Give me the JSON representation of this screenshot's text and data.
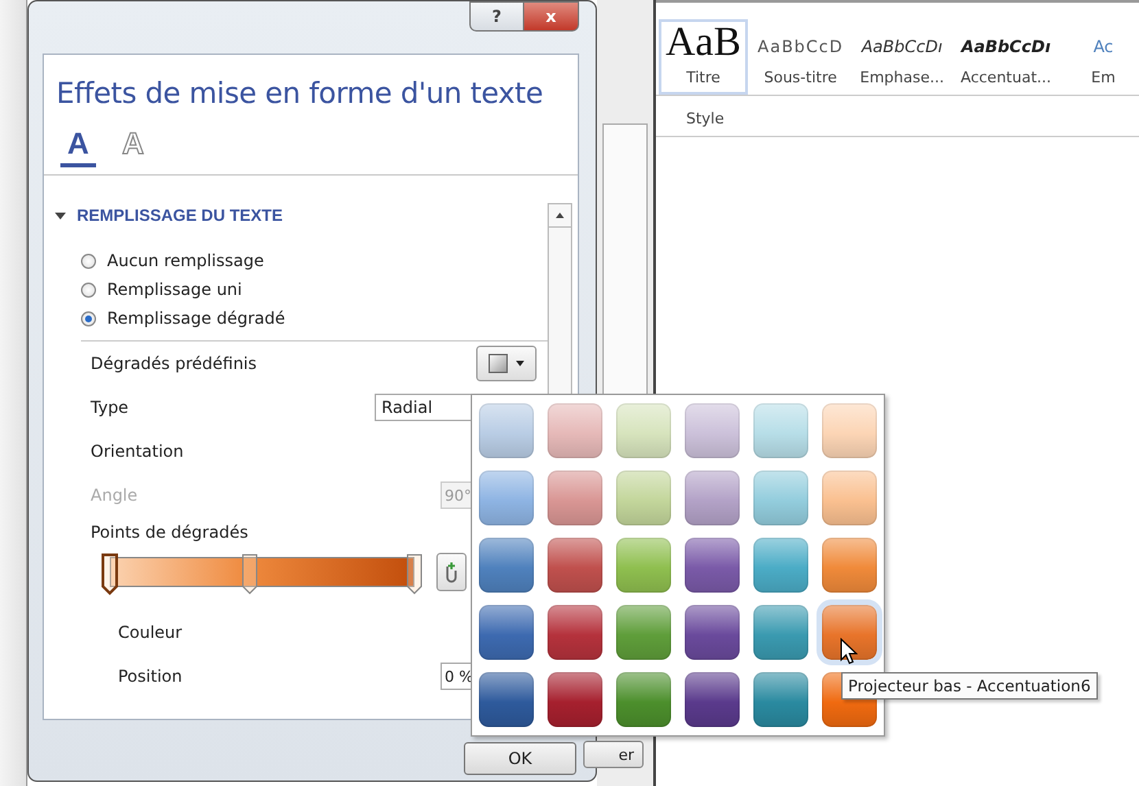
{
  "dialog": {
    "help_button": "?",
    "close_button": "x",
    "title": "Effets de mise en forme d'un texte",
    "tabs": [
      {
        "label": "A",
        "kind": "fill",
        "selected": true
      },
      {
        "label": "A",
        "kind": "outline",
        "selected": false
      }
    ],
    "section": {
      "title": "REMPLISSAGE DU TEXTE",
      "expanded": true
    },
    "fill_options": [
      {
        "label": "Aucun remplissage",
        "selected": false
      },
      {
        "label": "Remplissage uni",
        "selected": false
      },
      {
        "label": "Remplissage dégradé",
        "selected": true
      }
    ],
    "fields": [
      {
        "kind": "preset",
        "label": "Dégradés prédéfinis",
        "disabled": false
      },
      {
        "kind": "select",
        "label": "Type",
        "value": "Radial",
        "disabled": false
      },
      {
        "kind": "plain",
        "label": "Orientation",
        "disabled": false
      },
      {
        "kind": "spin",
        "label": "Angle",
        "value": "90°",
        "disabled": true
      },
      {
        "kind": "stops",
        "label": "Points de dégradés",
        "disabled": false,
        "stops": [
          {
            "level": 0,
            "selected": true
          },
          {
            "level": 0.46,
            "selected": false
          },
          {
            "level": 1,
            "selected": false
          }
        ]
      },
      {
        "kind": "sub",
        "label": "Couleur",
        "disabled": false
      },
      {
        "kind": "subspin",
        "label": "Position",
        "value": "0 %",
        "disabled": false
      }
    ],
    "ok_button": "OK"
  },
  "background_button": "er",
  "ribbon": {
    "styles": [
      {
        "kind": "title",
        "sample": "AaB",
        "label": "Titre",
        "selected": true
      },
      {
        "kind": "subtitle",
        "sample": "AaBbCcD",
        "label": "Sous-titre",
        "selected": false
      },
      {
        "kind": "emphasis",
        "sample": "AaBbCcDı",
        "label": "Emphase...",
        "selected": false
      },
      {
        "kind": "strong",
        "sample": "AaBbCcDı",
        "label": "Accentuat...",
        "selected": false
      },
      {
        "kind": "accent",
        "sample": "Ac",
        "label": "Em",
        "selected": false
      }
    ],
    "group_label": "Style"
  },
  "gallery": {
    "rows": [
      [
        {
          "color": "#b9cde5",
          "selected": false
        },
        {
          "color": "#e6b9b8",
          "selected": false
        },
        {
          "color": "#d7e4bd",
          "selected": false
        },
        {
          "color": "#ccc1da",
          "selected": false
        },
        {
          "color": "#b7dee8",
          "selected": false
        },
        {
          "color": "#fcd5b5",
          "selected": false
        }
      ],
      [
        {
          "color": "#8eb4e3",
          "selected": false
        },
        {
          "color": "#d99694",
          "selected": false
        },
        {
          "color": "#c3d69b",
          "selected": false
        },
        {
          "color": "#b3a2c7",
          "selected": false
        },
        {
          "color": "#93cddd",
          "selected": false
        },
        {
          "color": "#fac090",
          "selected": false
        }
      ],
      [
        {
          "color": "#4f81bd",
          "selected": false
        },
        {
          "color": "#c0504d",
          "selected": false
        },
        {
          "color": "#8fbf4f",
          "selected": false
        },
        {
          "color": "#7a5aa8",
          "selected": false
        },
        {
          "color": "#4bacc6",
          "selected": false
        },
        {
          "color": "#f08a3a",
          "selected": false
        }
      ],
      [
        {
          "color": "#3d6ab0",
          "selected": false
        },
        {
          "color": "#b5323c",
          "selected": false
        },
        {
          "color": "#5f9e3a",
          "selected": false
        },
        {
          "color": "#6a4a9c",
          "selected": false
        },
        {
          "color": "#3a9ab0",
          "selected": false
        },
        {
          "color": "#e8742a",
          "selected": true
        }
      ],
      [
        {
          "color": "#2e5a9c",
          "selected": false
        },
        {
          "color": "#a6202e",
          "selected": false
        },
        {
          "color": "#4c8f2c",
          "selected": false
        },
        {
          "color": "#5a3a8c",
          "selected": false
        },
        {
          "color": "#2a8aa0",
          "selected": false
        },
        {
          "color": "#f06a10",
          "selected": false
        }
      ]
    ],
    "tooltip": "Projecteur bas - Accentuation6"
  }
}
